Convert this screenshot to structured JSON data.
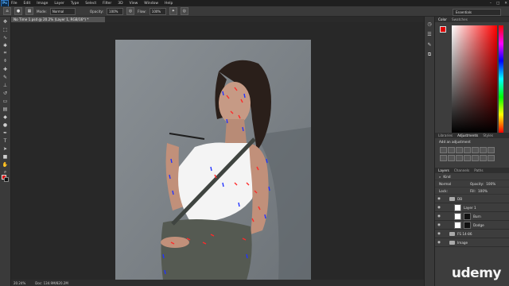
{
  "app": {
    "logo": "Ps",
    "menu": [
      "File",
      "Edit",
      "Image",
      "Layer",
      "Type",
      "Select",
      "Filter",
      "3D",
      "View",
      "Window",
      "Help"
    ],
    "window_controls": [
      "–",
      "□",
      "✕"
    ]
  },
  "options_bar": {
    "mode_label": "Mode:",
    "mode_value": "Normal",
    "opacity_label": "Opacity:",
    "opacity_value": "100%",
    "flow_label": "Flow:",
    "flow_value": "100%",
    "workspace": "Essentials"
  },
  "document": {
    "tab_title": "No Time 1.psd @ 20.2% (Layer 1, RGB/16*) *",
    "zoom": "20.24%",
    "doc_info": "Doc: 134.9M/820.2M"
  },
  "colors": {
    "foreground": "#e00000",
    "background": "#111111",
    "accent_red": "#ff2a2a",
    "accent_blue": "#2233ff"
  },
  "tools": [
    "move-icon",
    "marquee-icon",
    "lasso-icon",
    "quick-select-icon",
    "crop-icon",
    "eyedropper-icon",
    "healing-icon",
    "brush-icon",
    "clone-stamp-icon",
    "history-brush-icon",
    "eraser-icon",
    "gradient-icon",
    "blur-icon",
    "dodge-icon",
    "pen-icon",
    "type-icon",
    "path-select-icon",
    "rectangle-icon",
    "hand-icon",
    "zoom-icon"
  ],
  "panels": {
    "color_tabs": [
      "Color",
      "Swatches"
    ],
    "adjustment_tabs": [
      "Libraries",
      "Adjustments",
      "Styles"
    ],
    "adjustment_hint": "Add an adjustment",
    "layers_tabs": [
      "Layers",
      "Channels",
      "Paths"
    ],
    "kind_label": "Kind",
    "blend_mode": "Normal",
    "opacity_label": "Opacity:",
    "opacity_value": "100%",
    "lock_label": "Lock:",
    "fill_label": "Fill:",
    "fill_value": "100%",
    "layers": [
      {
        "name": "DB",
        "type": "folder",
        "indent": 0
      },
      {
        "name": "Layer 1",
        "type": "pixel",
        "indent": 1
      },
      {
        "name": "Burn",
        "type": "adjust",
        "indent": 1
      },
      {
        "name": "Dodge",
        "type": "adjust",
        "indent": 1
      },
      {
        "name": "FS 14-86",
        "type": "folder",
        "indent": 0
      },
      {
        "name": "Image",
        "type": "folder",
        "indent": 0
      }
    ]
  },
  "watermark": "udemy"
}
